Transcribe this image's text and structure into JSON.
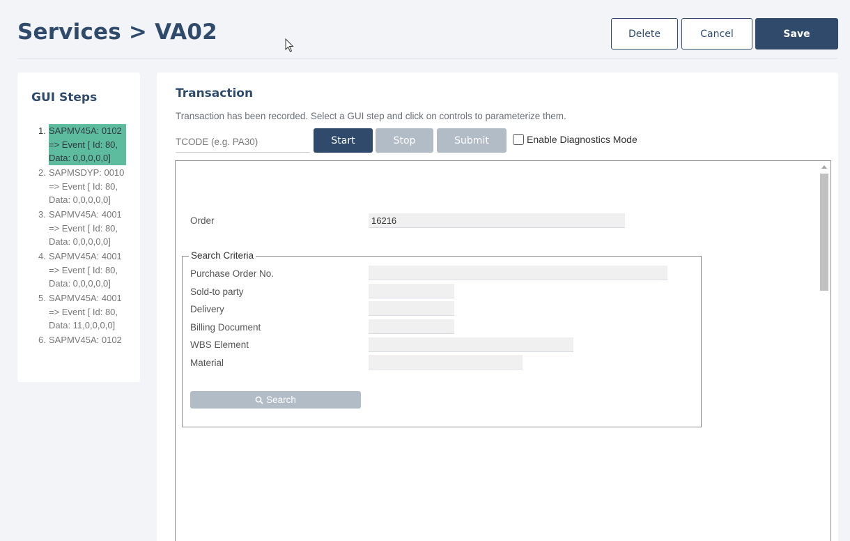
{
  "header": {
    "title": "Services > VA02",
    "delete_label": "Delete",
    "cancel_label": "Cancel",
    "save_label": "Save"
  },
  "gui_steps": {
    "title": "GUI Steps",
    "items": [
      {
        "num": "1.",
        "text": "SAPMV45A: 0102\n=> Event [ Id: 80,\nData: 0,0,0,0,0]",
        "active": true
      },
      {
        "num": "2.",
        "text": "SAPMSDYP: 0010\n=> Event [ Id: 80,\nData: 0,0,0,0,0]",
        "active": false
      },
      {
        "num": "3.",
        "text": "SAPMV45A: 4001\n=> Event [ Id: 80,\nData: 0,0,0,0,0]",
        "active": false
      },
      {
        "num": "4.",
        "text": "SAPMV45A: 4001\n=> Event [ Id: 80,\nData: 0,0,0,0,0]",
        "active": false
      },
      {
        "num": "5.",
        "text": "SAPMV45A: 4001\n=> Event [ Id: 80,\nData: 11,0,0,0,0]",
        "active": false
      },
      {
        "num": "6.",
        "text": "SAPMV45A: 0102",
        "active": false
      }
    ]
  },
  "transaction": {
    "title": "Transaction",
    "description": "Transaction has been recorded. Select a GUI step and click on controls to parameterize them.",
    "tcode_placeholder": "TCODE (e.g. PA30)",
    "start_label": "Start",
    "stop_label": "Stop",
    "submit_label": "Submit",
    "diagnostics_label": "Enable Diagnostics Mode"
  },
  "sap_screen": {
    "order_label": "Order",
    "order_value": "16216",
    "search_criteria_legend": "Search Criteria",
    "fields": [
      {
        "label": "Purchase Order No.",
        "value": ""
      },
      {
        "label": "Sold-to party",
        "value": ""
      },
      {
        "label": "Delivery",
        "value": ""
      },
      {
        "label": "Billing Document",
        "value": ""
      },
      {
        "label": "WBS Element",
        "value": ""
      },
      {
        "label": "Material",
        "value": ""
      }
    ],
    "search_button_label": "Search"
  },
  "colors": {
    "primary": "#2f4a6b",
    "disabled": "#b2bcc7",
    "active_step": "#5dbb9e"
  }
}
